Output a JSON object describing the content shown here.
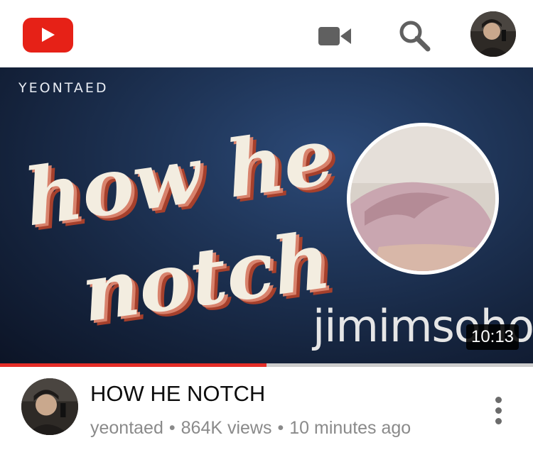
{
  "app": {
    "name": "YouTube"
  },
  "header": {
    "logo_icon": "youtube-play-icon",
    "brand_color": "#e62117",
    "icons": [
      "video-camera-icon",
      "search-icon",
      "account-avatar"
    ]
  },
  "video": {
    "thumbnail": {
      "channel_watermark": "YEONTAED",
      "title_art_line1": "how he",
      "title_art_line2": "notch",
      "overlay_name": "jimimsohok",
      "duration": "10:13"
    },
    "progress_fraction": 0.5,
    "progress_color": "#e52d27",
    "title": "HOW HE NOTCH",
    "channel": "yeontaed",
    "views": "864K views",
    "age": "10 minutes ago",
    "separator": "•"
  }
}
